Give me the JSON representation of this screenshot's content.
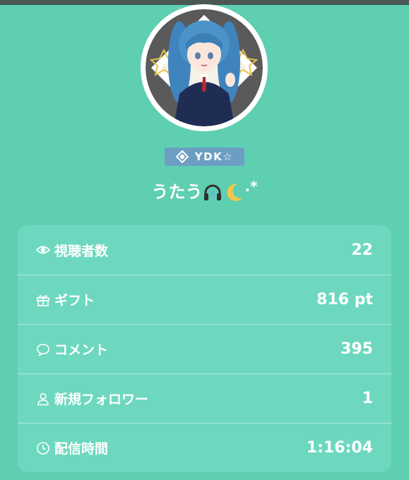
{
  "profile": {
    "tag_label": "YDK☆",
    "status_text": "うたう",
    "status_suffix": ".*"
  },
  "colors": {
    "background": "#5ecfb1",
    "card": "#6dd8bf",
    "tag": "#6c9ec2",
    "text": "#ffffff"
  },
  "stats": [
    {
      "icon": "eye-icon",
      "label": "視聴者数",
      "value": "22"
    },
    {
      "icon": "gift-icon",
      "label": "ギフト",
      "value": "816 pt"
    },
    {
      "icon": "speech-bubble-icon",
      "label": "コメント",
      "value": "395"
    },
    {
      "icon": "person-icon",
      "label": "新規フォロワー",
      "value": "1"
    },
    {
      "icon": "clock-icon",
      "label": "配信時間",
      "value": "1:16:04"
    }
  ]
}
